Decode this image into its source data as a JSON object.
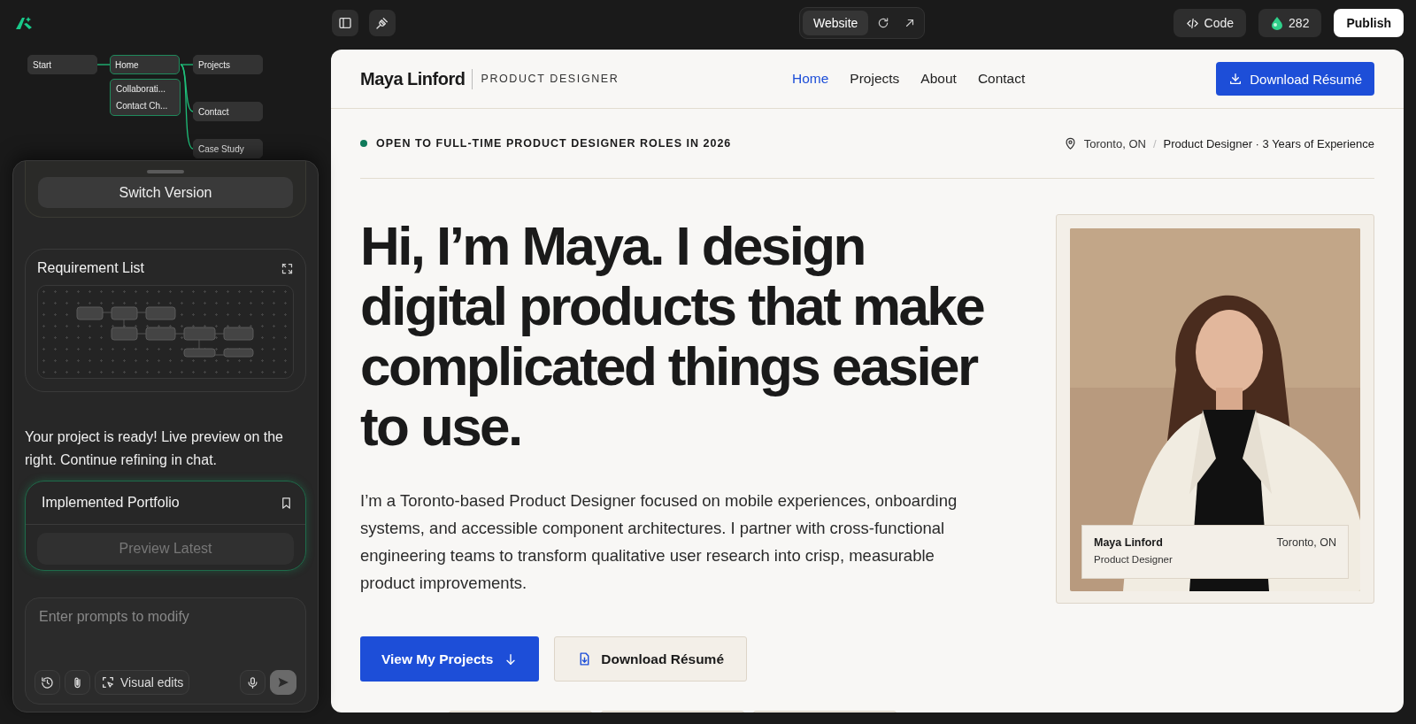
{
  "top_bar": {
    "view_tabs": [
      {
        "label": "Website",
        "selected": true
      }
    ],
    "code_button": "Code",
    "credits": "282",
    "publish_button": "Publish"
  },
  "flow": {
    "nodes": [
      {
        "kind": "page",
        "label": "Start",
        "selected": false
      },
      {
        "kind": "page",
        "label": "Home",
        "selected": true
      },
      {
        "kind": "page",
        "label": "Projects",
        "selected": false
      },
      {
        "kind": "group",
        "items": [
          "Collaborati...",
          "Contact Ch..."
        ],
        "selected": true
      },
      {
        "kind": "page",
        "label": "Contact",
        "selected": false
      },
      {
        "kind": "page",
        "label": "Case Study",
        "selected": false
      }
    ]
  },
  "chat": {
    "switch_button": "Switch Version",
    "requirement_card": {
      "title": "Requirement List"
    },
    "message": "Your project is ready! Live preview on the right. Continue refining in chat.",
    "result_card": {
      "title": "Implemented Portfolio",
      "button": "Preview Latest",
      "disabled": true
    },
    "prompt": {
      "placeholder": "Enter prompts to modify",
      "visual_edits_button": "Visual edits"
    }
  },
  "preview": {
    "brand": {
      "name": "Maya Linford",
      "role": "PRODUCT DESIGNER"
    },
    "nav": [
      {
        "label": "Home",
        "selected": true
      },
      {
        "label": "Projects",
        "selected": false
      },
      {
        "label": "About",
        "selected": false
      },
      {
        "label": "Contact",
        "selected": false
      }
    ],
    "header_button": "Download Résumé",
    "status": {
      "text": "OPEN TO FULL-TIME PRODUCT DESIGNER ROLES IN 2026",
      "location": "Toronto, ON",
      "separator": "/",
      "summary": "Product Designer · 3 Years of Experience"
    },
    "headline": "Hi, I’m Maya. I design digital products that make complicated things easier to use.",
    "intro": "I’m a Toronto-based Product Designer focused on mobile experiences, onboarding systems, and accessible component architectures. I partner with cross-functional engineering teams to transform qualitative user research into crisp, measurable product improvements.",
    "buttons": [
      {
        "kind": "primary",
        "label": "View My Projects"
      },
      {
        "kind": "secondary",
        "label": "Download Résumé"
      }
    ],
    "photo_caption": {
      "name": "Maya Linford",
      "role": "Product Designer",
      "location": "Toronto, ON"
    }
  }
}
